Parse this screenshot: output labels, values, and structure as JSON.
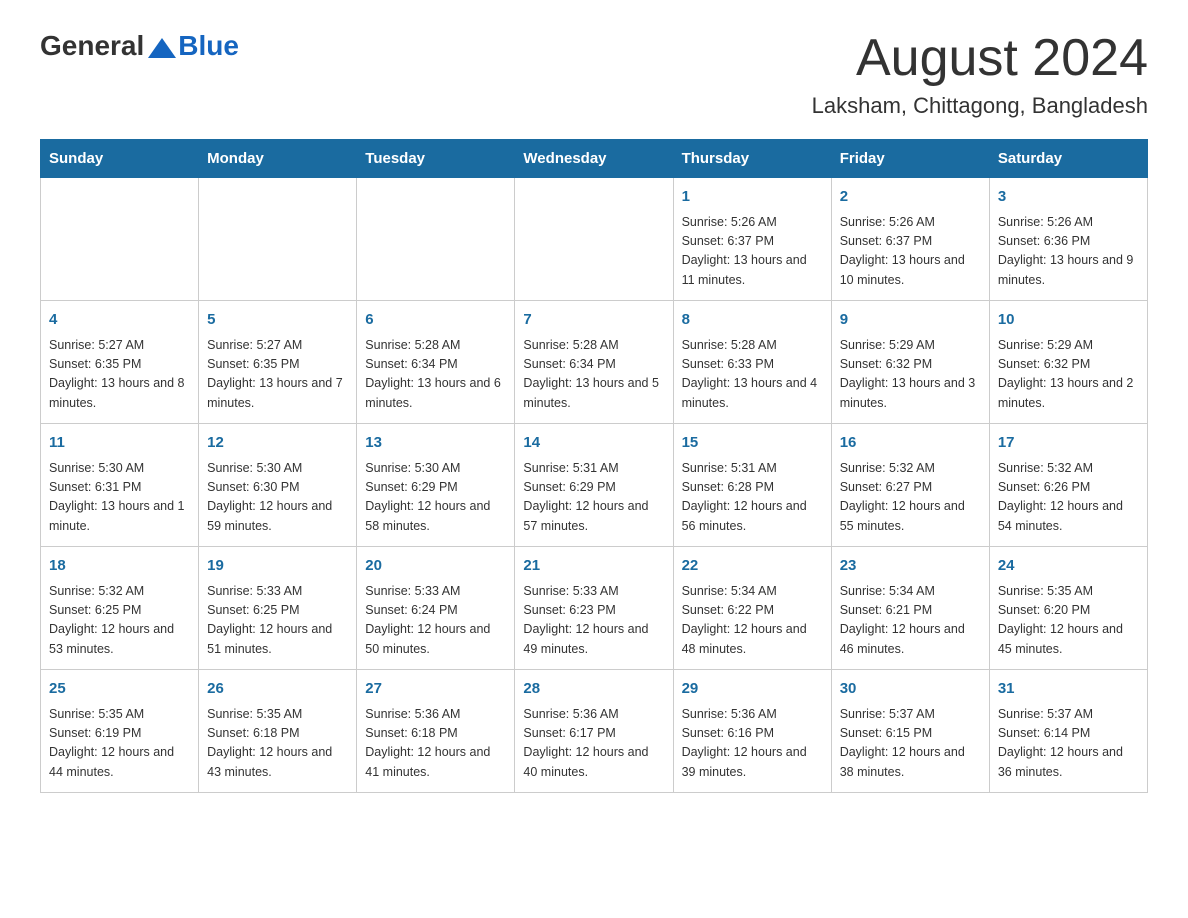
{
  "header": {
    "logo": {
      "general": "General",
      "blue": "Blue"
    },
    "month_title": "August 2024",
    "location": "Laksham, Chittagong, Bangladesh"
  },
  "days_of_week": [
    "Sunday",
    "Monday",
    "Tuesday",
    "Wednesday",
    "Thursday",
    "Friday",
    "Saturday"
  ],
  "weeks": [
    {
      "days": [
        {
          "number": "",
          "info": ""
        },
        {
          "number": "",
          "info": ""
        },
        {
          "number": "",
          "info": ""
        },
        {
          "number": "",
          "info": ""
        },
        {
          "number": "1",
          "info": "Sunrise: 5:26 AM\nSunset: 6:37 PM\nDaylight: 13 hours and 11 minutes."
        },
        {
          "number": "2",
          "info": "Sunrise: 5:26 AM\nSunset: 6:37 PM\nDaylight: 13 hours and 10 minutes."
        },
        {
          "number": "3",
          "info": "Sunrise: 5:26 AM\nSunset: 6:36 PM\nDaylight: 13 hours and 9 minutes."
        }
      ]
    },
    {
      "days": [
        {
          "number": "4",
          "info": "Sunrise: 5:27 AM\nSunset: 6:35 PM\nDaylight: 13 hours and 8 minutes."
        },
        {
          "number": "5",
          "info": "Sunrise: 5:27 AM\nSunset: 6:35 PM\nDaylight: 13 hours and 7 minutes."
        },
        {
          "number": "6",
          "info": "Sunrise: 5:28 AM\nSunset: 6:34 PM\nDaylight: 13 hours and 6 minutes."
        },
        {
          "number": "7",
          "info": "Sunrise: 5:28 AM\nSunset: 6:34 PM\nDaylight: 13 hours and 5 minutes."
        },
        {
          "number": "8",
          "info": "Sunrise: 5:28 AM\nSunset: 6:33 PM\nDaylight: 13 hours and 4 minutes."
        },
        {
          "number": "9",
          "info": "Sunrise: 5:29 AM\nSunset: 6:32 PM\nDaylight: 13 hours and 3 minutes."
        },
        {
          "number": "10",
          "info": "Sunrise: 5:29 AM\nSunset: 6:32 PM\nDaylight: 13 hours and 2 minutes."
        }
      ]
    },
    {
      "days": [
        {
          "number": "11",
          "info": "Sunrise: 5:30 AM\nSunset: 6:31 PM\nDaylight: 13 hours and 1 minute."
        },
        {
          "number": "12",
          "info": "Sunrise: 5:30 AM\nSunset: 6:30 PM\nDaylight: 12 hours and 59 minutes."
        },
        {
          "number": "13",
          "info": "Sunrise: 5:30 AM\nSunset: 6:29 PM\nDaylight: 12 hours and 58 minutes."
        },
        {
          "number": "14",
          "info": "Sunrise: 5:31 AM\nSunset: 6:29 PM\nDaylight: 12 hours and 57 minutes."
        },
        {
          "number": "15",
          "info": "Sunrise: 5:31 AM\nSunset: 6:28 PM\nDaylight: 12 hours and 56 minutes."
        },
        {
          "number": "16",
          "info": "Sunrise: 5:32 AM\nSunset: 6:27 PM\nDaylight: 12 hours and 55 minutes."
        },
        {
          "number": "17",
          "info": "Sunrise: 5:32 AM\nSunset: 6:26 PM\nDaylight: 12 hours and 54 minutes."
        }
      ]
    },
    {
      "days": [
        {
          "number": "18",
          "info": "Sunrise: 5:32 AM\nSunset: 6:25 PM\nDaylight: 12 hours and 53 minutes."
        },
        {
          "number": "19",
          "info": "Sunrise: 5:33 AM\nSunset: 6:25 PM\nDaylight: 12 hours and 51 minutes."
        },
        {
          "number": "20",
          "info": "Sunrise: 5:33 AM\nSunset: 6:24 PM\nDaylight: 12 hours and 50 minutes."
        },
        {
          "number": "21",
          "info": "Sunrise: 5:33 AM\nSunset: 6:23 PM\nDaylight: 12 hours and 49 minutes."
        },
        {
          "number": "22",
          "info": "Sunrise: 5:34 AM\nSunset: 6:22 PM\nDaylight: 12 hours and 48 minutes."
        },
        {
          "number": "23",
          "info": "Sunrise: 5:34 AM\nSunset: 6:21 PM\nDaylight: 12 hours and 46 minutes."
        },
        {
          "number": "24",
          "info": "Sunrise: 5:35 AM\nSunset: 6:20 PM\nDaylight: 12 hours and 45 minutes."
        }
      ]
    },
    {
      "days": [
        {
          "number": "25",
          "info": "Sunrise: 5:35 AM\nSunset: 6:19 PM\nDaylight: 12 hours and 44 minutes."
        },
        {
          "number": "26",
          "info": "Sunrise: 5:35 AM\nSunset: 6:18 PM\nDaylight: 12 hours and 43 minutes."
        },
        {
          "number": "27",
          "info": "Sunrise: 5:36 AM\nSunset: 6:18 PM\nDaylight: 12 hours and 41 minutes."
        },
        {
          "number": "28",
          "info": "Sunrise: 5:36 AM\nSunset: 6:17 PM\nDaylight: 12 hours and 40 minutes."
        },
        {
          "number": "29",
          "info": "Sunrise: 5:36 AM\nSunset: 6:16 PM\nDaylight: 12 hours and 39 minutes."
        },
        {
          "number": "30",
          "info": "Sunrise: 5:37 AM\nSunset: 6:15 PM\nDaylight: 12 hours and 38 minutes."
        },
        {
          "number": "31",
          "info": "Sunrise: 5:37 AM\nSunset: 6:14 PM\nDaylight: 12 hours and 36 minutes."
        }
      ]
    }
  ]
}
